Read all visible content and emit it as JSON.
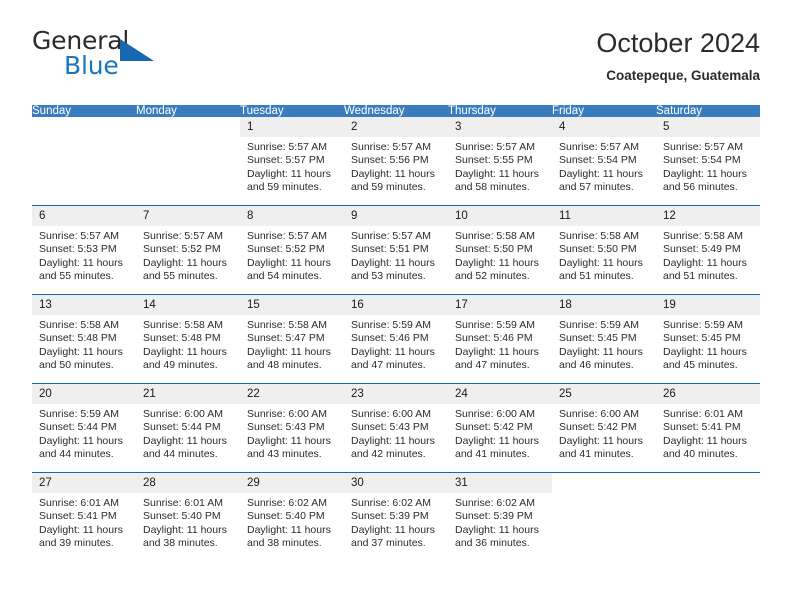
{
  "brand": {
    "name_part1": "General",
    "name_part2": "Blue",
    "triangle_color": "#1668b0",
    "blue_color": "#1b76bc"
  },
  "header": {
    "month_title": "October 2024",
    "location": "Coatepeque, Guatemala"
  },
  "theme": {
    "header_row_bg": "#3a7dbf",
    "header_row_text": "#ffffff",
    "week_separator": "#1668b0",
    "daynum_band_bg": "#efefef"
  },
  "weekdays": [
    "Sunday",
    "Monday",
    "Tuesday",
    "Wednesday",
    "Thursday",
    "Friday",
    "Saturday"
  ],
  "labels": {
    "sunrise_prefix": "Sunrise:",
    "sunset_prefix": "Sunset:",
    "daylight_prefix": "Daylight:"
  },
  "weeks": [
    [
      {
        "day": "",
        "sunrise": "",
        "sunset": "",
        "daylight": "",
        "blank": true
      },
      {
        "day": "",
        "sunrise": "",
        "sunset": "",
        "daylight": "",
        "blank": true
      },
      {
        "day": "1",
        "sunrise": "Sunrise: 5:57 AM",
        "sunset": "Sunset: 5:57 PM",
        "daylight": "Daylight: 11 hours and 59 minutes."
      },
      {
        "day": "2",
        "sunrise": "Sunrise: 5:57 AM",
        "sunset": "Sunset: 5:56 PM",
        "daylight": "Daylight: 11 hours and 59 minutes."
      },
      {
        "day": "3",
        "sunrise": "Sunrise: 5:57 AM",
        "sunset": "Sunset: 5:55 PM",
        "daylight": "Daylight: 11 hours and 58 minutes."
      },
      {
        "day": "4",
        "sunrise": "Sunrise: 5:57 AM",
        "sunset": "Sunset: 5:54 PM",
        "daylight": "Daylight: 11 hours and 57 minutes."
      },
      {
        "day": "5",
        "sunrise": "Sunrise: 5:57 AM",
        "sunset": "Sunset: 5:54 PM",
        "daylight": "Daylight: 11 hours and 56 minutes."
      }
    ],
    [
      {
        "day": "6",
        "sunrise": "Sunrise: 5:57 AM",
        "sunset": "Sunset: 5:53 PM",
        "daylight": "Daylight: 11 hours and 55 minutes."
      },
      {
        "day": "7",
        "sunrise": "Sunrise: 5:57 AM",
        "sunset": "Sunset: 5:52 PM",
        "daylight": "Daylight: 11 hours and 55 minutes."
      },
      {
        "day": "8",
        "sunrise": "Sunrise: 5:57 AM",
        "sunset": "Sunset: 5:52 PM",
        "daylight": "Daylight: 11 hours and 54 minutes."
      },
      {
        "day": "9",
        "sunrise": "Sunrise: 5:57 AM",
        "sunset": "Sunset: 5:51 PM",
        "daylight": "Daylight: 11 hours and 53 minutes."
      },
      {
        "day": "10",
        "sunrise": "Sunrise: 5:58 AM",
        "sunset": "Sunset: 5:50 PM",
        "daylight": "Daylight: 11 hours and 52 minutes."
      },
      {
        "day": "11",
        "sunrise": "Sunrise: 5:58 AM",
        "sunset": "Sunset: 5:50 PM",
        "daylight": "Daylight: 11 hours and 51 minutes."
      },
      {
        "day": "12",
        "sunrise": "Sunrise: 5:58 AM",
        "sunset": "Sunset: 5:49 PM",
        "daylight": "Daylight: 11 hours and 51 minutes."
      }
    ],
    [
      {
        "day": "13",
        "sunrise": "Sunrise: 5:58 AM",
        "sunset": "Sunset: 5:48 PM",
        "daylight": "Daylight: 11 hours and 50 minutes."
      },
      {
        "day": "14",
        "sunrise": "Sunrise: 5:58 AM",
        "sunset": "Sunset: 5:48 PM",
        "daylight": "Daylight: 11 hours and 49 minutes."
      },
      {
        "day": "15",
        "sunrise": "Sunrise: 5:58 AM",
        "sunset": "Sunset: 5:47 PM",
        "daylight": "Daylight: 11 hours and 48 minutes."
      },
      {
        "day": "16",
        "sunrise": "Sunrise: 5:59 AM",
        "sunset": "Sunset: 5:46 PM",
        "daylight": "Daylight: 11 hours and 47 minutes."
      },
      {
        "day": "17",
        "sunrise": "Sunrise: 5:59 AM",
        "sunset": "Sunset: 5:46 PM",
        "daylight": "Daylight: 11 hours and 47 minutes."
      },
      {
        "day": "18",
        "sunrise": "Sunrise: 5:59 AM",
        "sunset": "Sunset: 5:45 PM",
        "daylight": "Daylight: 11 hours and 46 minutes."
      },
      {
        "day": "19",
        "sunrise": "Sunrise: 5:59 AM",
        "sunset": "Sunset: 5:45 PM",
        "daylight": "Daylight: 11 hours and 45 minutes."
      }
    ],
    [
      {
        "day": "20",
        "sunrise": "Sunrise: 5:59 AM",
        "sunset": "Sunset: 5:44 PM",
        "daylight": "Daylight: 11 hours and 44 minutes."
      },
      {
        "day": "21",
        "sunrise": "Sunrise: 6:00 AM",
        "sunset": "Sunset: 5:44 PM",
        "daylight": "Daylight: 11 hours and 44 minutes."
      },
      {
        "day": "22",
        "sunrise": "Sunrise: 6:00 AM",
        "sunset": "Sunset: 5:43 PM",
        "daylight": "Daylight: 11 hours and 43 minutes."
      },
      {
        "day": "23",
        "sunrise": "Sunrise: 6:00 AM",
        "sunset": "Sunset: 5:43 PM",
        "daylight": "Daylight: 11 hours and 42 minutes."
      },
      {
        "day": "24",
        "sunrise": "Sunrise: 6:00 AM",
        "sunset": "Sunset: 5:42 PM",
        "daylight": "Daylight: 11 hours and 41 minutes."
      },
      {
        "day": "25",
        "sunrise": "Sunrise: 6:00 AM",
        "sunset": "Sunset: 5:42 PM",
        "daylight": "Daylight: 11 hours and 41 minutes."
      },
      {
        "day": "26",
        "sunrise": "Sunrise: 6:01 AM",
        "sunset": "Sunset: 5:41 PM",
        "daylight": "Daylight: 11 hours and 40 minutes."
      }
    ],
    [
      {
        "day": "27",
        "sunrise": "Sunrise: 6:01 AM",
        "sunset": "Sunset: 5:41 PM",
        "daylight": "Daylight: 11 hours and 39 minutes."
      },
      {
        "day": "28",
        "sunrise": "Sunrise: 6:01 AM",
        "sunset": "Sunset: 5:40 PM",
        "daylight": "Daylight: 11 hours and 38 minutes."
      },
      {
        "day": "29",
        "sunrise": "Sunrise: 6:02 AM",
        "sunset": "Sunset: 5:40 PM",
        "daylight": "Daylight: 11 hours and 38 minutes."
      },
      {
        "day": "30",
        "sunrise": "Sunrise: 6:02 AM",
        "sunset": "Sunset: 5:39 PM",
        "daylight": "Daylight: 11 hours and 37 minutes."
      },
      {
        "day": "31",
        "sunrise": "Sunrise: 6:02 AM",
        "sunset": "Sunset: 5:39 PM",
        "daylight": "Daylight: 11 hours and 36 minutes."
      },
      {
        "day": "",
        "sunrise": "",
        "sunset": "",
        "daylight": "",
        "blank": true
      },
      {
        "day": "",
        "sunrise": "",
        "sunset": "",
        "daylight": "",
        "blank": true
      }
    ]
  ]
}
